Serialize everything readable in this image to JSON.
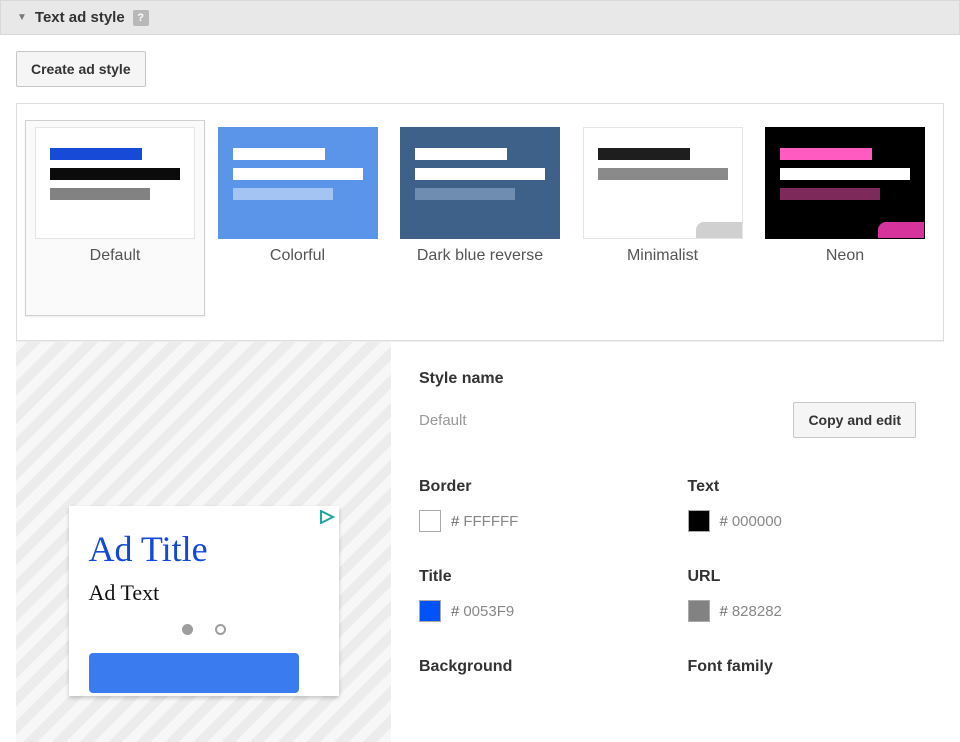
{
  "section": {
    "title": "Text ad style",
    "help": "?"
  },
  "create_button_label": "Create ad style",
  "gallery": {
    "styles": [
      {
        "name": "Default",
        "selected": true,
        "bg": "#ffffff",
        "bar1": "#174ad6",
        "bar2": "#0b0b0b",
        "bar3": "#828282",
        "stub": null,
        "border": "#e5e5e5"
      },
      {
        "name": "Colorful",
        "selected": false,
        "bg": "#5b95ea",
        "bar1": "#ffffff",
        "bar2": "#ffffff",
        "bar3": "#a4c5f4",
        "stub": null,
        "border": "#5b95ea"
      },
      {
        "name": "Dark blue reverse",
        "selected": false,
        "bg": "#3d6189",
        "bar1": "#ffffff",
        "bar2": "#ffffff",
        "bar3": "#6f8db0",
        "stub": null,
        "border": "#3d6189"
      },
      {
        "name": "Minimalist",
        "selected": false,
        "bg": "#ffffff",
        "bar1": "#1e1e1e",
        "bar2": "#8a8a8a",
        "bar3": null,
        "stub": "#d0d0d0",
        "border": "#e5e5e5"
      },
      {
        "name": "Neon",
        "selected": false,
        "bg": "#000000",
        "bar1": "#ff5bc1",
        "bar2": "#ffffff",
        "bar3": "#7d2a5a",
        "stub": "#d6339c",
        "border": "#000000"
      }
    ]
  },
  "form": {
    "style_name_label": "Style name",
    "style_name_value": "Default",
    "copy_edit_label": "Copy and edit",
    "border": {
      "label": "Border",
      "color": "#FFFFFF",
      "hex": "FFFFFF"
    },
    "text": {
      "label": "Text",
      "color": "#000000",
      "hex": "000000"
    },
    "title": {
      "label": "Title",
      "color": "#0053F9",
      "hex": "0053F9"
    },
    "url": {
      "label": "URL",
      "color": "#828282",
      "hex": "828282"
    },
    "background_label": "Background",
    "font_family_label": "Font family"
  },
  "preview": {
    "ad_title": "Ad Title",
    "ad_text": "Ad Text"
  }
}
